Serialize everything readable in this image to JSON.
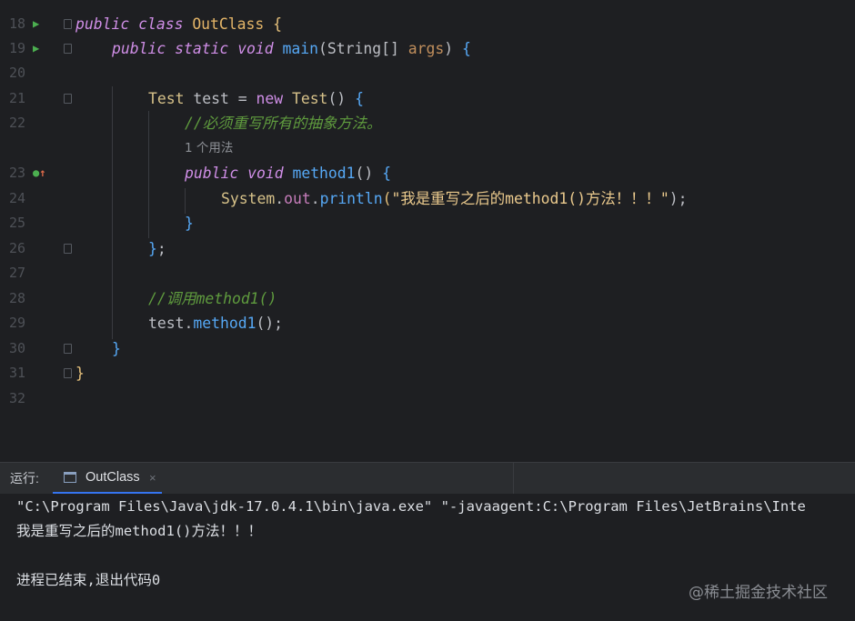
{
  "editor": {
    "line_numbers": [
      "18",
      "19",
      "20",
      "21",
      "22",
      "23",
      "24",
      "25",
      "26",
      "27",
      "28",
      "29",
      "30",
      "31",
      "32"
    ],
    "code": {
      "l18": {
        "kw1": "public",
        "kw2": "class",
        "name": "OutClass",
        "brace": "{"
      },
      "l19": {
        "kw1": "public",
        "kw2": "static",
        "kw3": "void",
        "name": "main",
        "open": "(",
        "type": "String[]",
        "param": "args",
        "close": ")",
        "brace": "{"
      },
      "l21": {
        "type": "Test",
        "var": "test",
        "eq": "=",
        "kw": "new",
        "ctor": "Test",
        "parens": "()",
        "brace": "{"
      },
      "l22": {
        "comment": "//必须重写所有的抽象方法。"
      },
      "hint": "1 个用法",
      "l23": {
        "kw1": "public",
        "kw2": "void",
        "name": "method1",
        "parens": "()",
        "brace": "{"
      },
      "l24": {
        "cls": "System",
        "dot1": ".",
        "field": "out",
        "dot2": ".",
        "fn": "println",
        "open": "(",
        "str": "\"我是重写之后的method1()方法！！！\"",
        "close": ");"
      },
      "l25": {
        "brace": "}"
      },
      "l26": {
        "brace": "}",
        "semi": ";"
      },
      "l28": {
        "comment": "//调用method1()"
      },
      "l29": {
        "var": "test",
        "dot": ".",
        "fn": "method1",
        "rest": "();"
      },
      "l30": {
        "brace": "}"
      },
      "l31": {
        "brace": "}"
      }
    },
    "gutter_icons": {
      "run": "run-triangle-icon",
      "override": "implements-override-icon"
    }
  },
  "run_panel": {
    "label": "运行:",
    "tab": "OutClass",
    "tab_close": "×",
    "output": [
      "\"C:\\Program Files\\Java\\jdk-17.0.4.1\\bin\\java.exe\" \"-javaagent:C:\\Program Files\\JetBrains\\Inte",
      "我是重写之后的method1()方法！！！",
      "",
      "进程已结束,退出代码0"
    ]
  },
  "watermark": "@稀土掘金技术社区",
  "colors": {
    "background": "#1e1f22",
    "keyword": "#cf8ee6",
    "function": "#56a8f5",
    "string": "#ebca8d",
    "comment": "#5f9b3e",
    "run_icon": "#4caf50",
    "tab_underline": "#3574f0"
  }
}
